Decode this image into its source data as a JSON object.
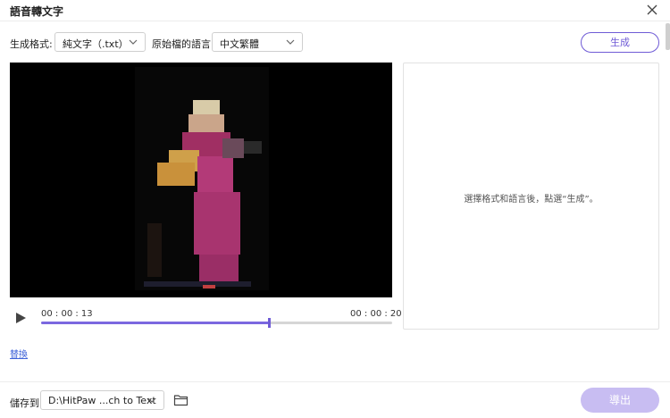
{
  "window": {
    "title": "語音轉文字"
  },
  "icons": {
    "close": "close-icon",
    "chevron": "chevron-down-icon",
    "play": "play-icon",
    "folder": "folder-icon"
  },
  "options": {
    "format_label": "生成格式:",
    "format_value": "純文字（.txt）",
    "language_label": "原始檔的語言:",
    "language_value": "中文繁體"
  },
  "actions": {
    "generate_label": "生成",
    "export_label": "導出",
    "replace_label": "替換"
  },
  "player": {
    "current_time": "00 : 00 : 13",
    "total_time": "00 : 00 : 20",
    "progress": 0.65
  },
  "result_panel": {
    "hint": "選擇格式和語言後，點選“生成”。"
  },
  "footer": {
    "save_label": "儲存到:",
    "save_path": "D:\\HitPaw ...ch to Text"
  },
  "colors": {
    "accent": "#6f5bd6",
    "export_disabled": "#c8bdf2",
    "link": "#3f63d8"
  }
}
